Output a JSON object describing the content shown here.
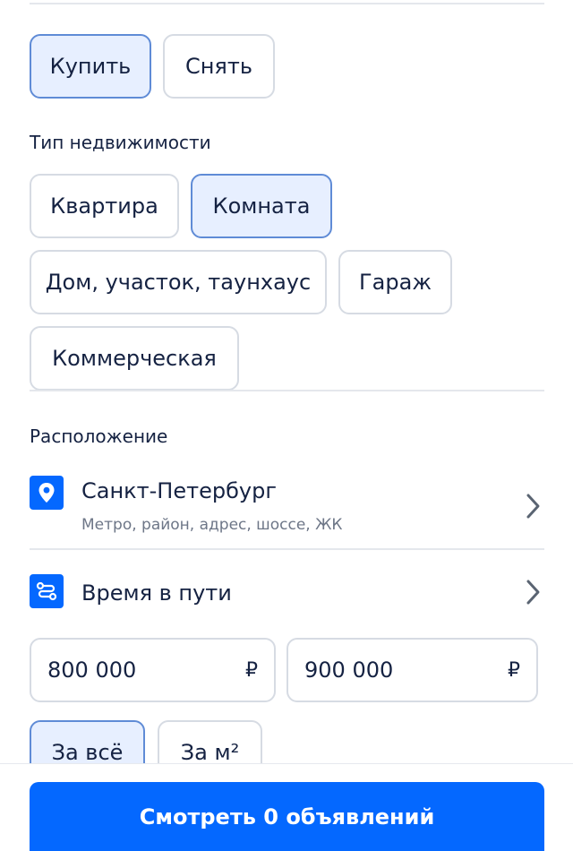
{
  "deal_type": {
    "buy": "Купить",
    "rent": "Снять",
    "selected": "buy"
  },
  "property_type": {
    "title": "Тип недвижимости",
    "options": [
      "Квартира",
      "Комната",
      "Дом, участок, таунхаус",
      "Гараж",
      "Коммерческая"
    ],
    "selected": "Комната"
  },
  "location": {
    "title": "Расположение",
    "city": "Санкт-Петербург",
    "hint": "Метро, район, адрес, шоссе, ЖК",
    "icon": "location-pin-icon"
  },
  "travel_time": {
    "label": "Время в пути",
    "icon": "route-icon"
  },
  "price": {
    "from": "800 000",
    "to": "900 000",
    "currency": "₽",
    "mode_total": "За всё",
    "mode_sqm": "За м²",
    "selected_mode": "total"
  },
  "cta": {
    "label": "Смотреть 0 объявлений"
  },
  "colors": {
    "accent": "#0468ff",
    "selected_bg": "#e7efff",
    "selected_border": "#5f8bd6",
    "text": "#152242",
    "muted": "#6d7687"
  }
}
